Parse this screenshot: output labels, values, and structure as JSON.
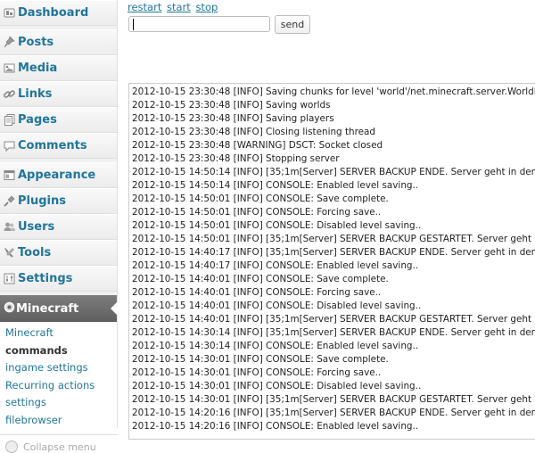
{
  "menu": [
    {
      "label": "Dashboard",
      "icon": "dashboard-icon",
      "sep_after": true
    },
    {
      "label": "Posts",
      "icon": "pushpin-icon"
    },
    {
      "label": "Media",
      "icon": "media-icon"
    },
    {
      "label": "Links",
      "icon": "chain-link-icon"
    },
    {
      "label": "Pages",
      "icon": "pages-icon"
    },
    {
      "label": "Comments",
      "icon": "comment-bubble-icon",
      "sep_after": true
    },
    {
      "label": "Appearance",
      "icon": "appearance-icon"
    },
    {
      "label": "Plugins",
      "icon": "plug-icon"
    },
    {
      "label": "Users",
      "icon": "users-icon"
    },
    {
      "label": "Tools",
      "icon": "tools-icon"
    },
    {
      "label": "Settings",
      "icon": "settings-icon"
    }
  ],
  "current_menu": {
    "label": "Minecraft",
    "icon": "gear-icon"
  },
  "submenu": [
    {
      "label": "Minecraft",
      "current": false
    },
    {
      "label": "commands",
      "current": true
    },
    {
      "label": "ingame settings",
      "current": false
    },
    {
      "label": "Recurring actions",
      "current": false
    },
    {
      "label": "settings",
      "current": false
    },
    {
      "label": "filebrowser",
      "current": false
    }
  ],
  "collapse_label": "Collapse menu",
  "controls": {
    "restart": "restart",
    "start": "start",
    "stop": "stop"
  },
  "command": {
    "value": "",
    "send_label": "send"
  },
  "log_lines": [
    "2012-10-15 23:30:48 [INFO] Saving chunks for level 'world'/net.minecraft.server.WorldProviderNormal",
    "2012-10-15 23:30:48 [INFO] Saving worlds",
    "2012-10-15 23:30:48 [INFO] Saving players",
    "2012-10-15 23:30:48 [INFO] Closing listening thread",
    "2012-10-15 23:30:48 [WARNING] DSCT: Socket closed",
    "2012-10-15 23:30:48 [INFO] Stopping server",
    "2012-10-15 14:50:14 [INFO] [35;1m[Server] SERVER BACKUP ENDE. Server geht in den Normalbetrieb",
    "2012-10-15 14:50:14 [INFO] CONSOLE: Enabled level saving..",
    "2012-10-15 14:50:01 [INFO] CONSOLE: Save complete.",
    "2012-10-15 14:50:01 [INFO] CONSOLE: Forcing save..",
    "2012-10-15 14:50:01 [INFO] CONSOLE: Disabled level saving..",
    "2012-10-15 14:50:01 [INFO] [35;1m[Server] SERVER BACKUP GESTARTET. Server geht in den Readonly",
    "2012-10-15 14:40:17 [INFO] [35;1m[Server] SERVER BACKUP ENDE. Server geht in den Normalbetrieb",
    "2012-10-15 14:40:17 [INFO] CONSOLE: Enabled level saving..",
    "2012-10-15 14:40:01 [INFO] CONSOLE: Save complete.",
    "2012-10-15 14:40:01 [INFO] CONSOLE: Forcing save..",
    "2012-10-15 14:40:01 [INFO] CONSOLE: Disabled level saving..",
    "2012-10-15 14:40:01 [INFO] [35;1m[Server] SERVER BACKUP GESTARTET. Server geht in den Readonly",
    "2012-10-15 14:30:14 [INFO] [35;1m[Server] SERVER BACKUP ENDE. Server geht in den Normalbetrieb",
    "2012-10-15 14:30:14 [INFO] CONSOLE: Enabled level saving..",
    "2012-10-15 14:30:01 [INFO] CONSOLE: Save complete.",
    "2012-10-15 14:30:01 [INFO] CONSOLE: Forcing save..",
    "2012-10-15 14:30:01 [INFO] CONSOLE: Disabled level saving..",
    "2012-10-15 14:30:01 [INFO] [35;1m[Server] SERVER BACKUP GESTARTET. Server geht in den Readonly",
    "2012-10-15 14:20:16 [INFO] [35;1m[Server] SERVER BACKUP ENDE. Server geht in den Normalbetrieb",
    "2012-10-15 14:20:16 [INFO] CONSOLE: Enabled level saving.."
  ]
}
